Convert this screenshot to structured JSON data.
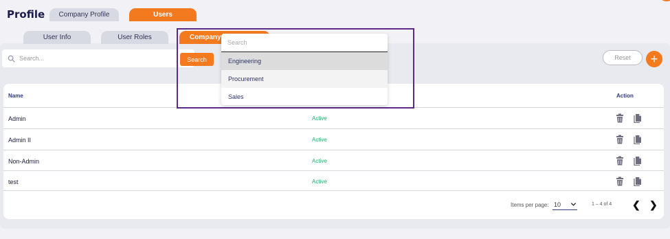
{
  "page": {
    "title": "Profile"
  },
  "top_tabs": [
    {
      "label": "Company Profile",
      "active": false
    },
    {
      "label": "Users",
      "active": true
    }
  ],
  "sub_tabs": [
    {
      "label": "User Info",
      "active": false
    },
    {
      "label": "User Roles",
      "active": false
    },
    {
      "label": "Company",
      "active": true
    }
  ],
  "toolbar": {
    "search_placeholder": "Search...",
    "search_button": "Search",
    "reset_button": "Reset",
    "add_button": "+"
  },
  "table": {
    "headers": {
      "name": "Name",
      "action": "Action"
    },
    "rows": [
      {
        "name": "Admin",
        "status": "Active"
      },
      {
        "name": "Admin II",
        "status": "Active"
      },
      {
        "name": "Non-Admin",
        "status": "Active"
      },
      {
        "name": "test",
        "status": "Active"
      }
    ]
  },
  "pager": {
    "items_label": "Items per page:",
    "page_size": "10",
    "range": "1 – 4 of 4",
    "prev": "❮",
    "next": "❯"
  },
  "dropdown": {
    "search_placeholder": "Search",
    "options": [
      "Engineering",
      "Procurement",
      "Sales"
    ],
    "selected": "Engineering",
    "hovered": "Procurement"
  },
  "colors": {
    "accent": "#f47a20",
    "status_active": "#2aa870",
    "highlight_outline": "#5b2a86"
  }
}
